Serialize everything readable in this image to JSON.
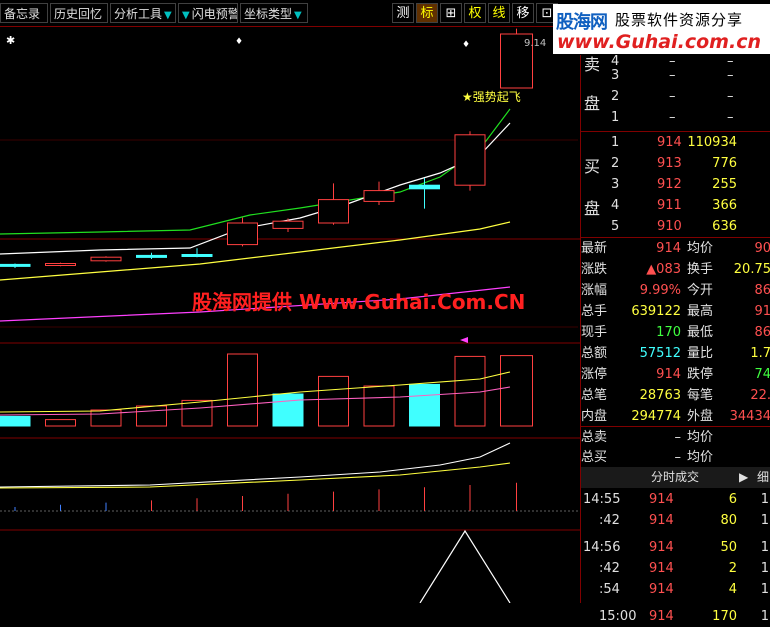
{
  "toolbar": {
    "memo": "备忘录",
    "history": "历史回忆",
    "analysis": "分析工具",
    "flash": "闪电预警",
    "coord": "坐标类型",
    "sq_measure": "测",
    "sq_mark": "标",
    "sq_plus": "⊞",
    "sq_right": "权",
    "sq_line": "线",
    "sq_move": "移",
    "sq_more": "⊡"
  },
  "logo": {
    "brand": "股海网",
    "slogan": "股票软件资源分享",
    "url": "www.Guhai.com.cn"
  },
  "chart": {
    "annotation": "★强势起飞",
    "price_label": "9.14",
    "watermark": "股海网提供 Www.Guhai.Com.CN"
  },
  "orderbook": {
    "sell_label_1": "卖",
    "sell_label_2": "盘",
    "buy_label_1": "买",
    "buy_label_2": "盘",
    "sell": [
      {
        "level": "4",
        "price": "–",
        "vol": "–"
      },
      {
        "level": "3",
        "price": "–",
        "vol": "–"
      },
      {
        "level": "2",
        "price": "–",
        "vol": "–"
      },
      {
        "level": "1",
        "price": "–",
        "vol": "–"
      }
    ],
    "buy": [
      {
        "level": "1",
        "price": "914",
        "vol": "110934"
      },
      {
        "level": "2",
        "price": "913",
        "vol": "776"
      },
      {
        "level": "3",
        "price": "912",
        "vol": "255"
      },
      {
        "level": "4",
        "price": "911",
        "vol": "366"
      },
      {
        "level": "5",
        "price": "910",
        "vol": "636"
      }
    ]
  },
  "quote": [
    {
      "l1": "最新",
      "v1": "914",
      "l2": "均价",
      "v2": "90"
    },
    {
      "l1": "涨跌",
      "v1": "▲083",
      "l2": "换手",
      "v2": "20.75"
    },
    {
      "l1": "涨幅",
      "v1": "9.99%",
      "l2": "今开",
      "v2": "86"
    },
    {
      "l1": "总手",
      "v1": "639122",
      "l2": "最高",
      "v2": "91"
    },
    {
      "l1": "现手",
      "v1": "170",
      "l2": "最低",
      "v2": "86"
    },
    {
      "l1": "总额",
      "v1": "57512",
      "l2": "量比",
      "v2": "1.7"
    },
    {
      "l1": "涨停",
      "v1": "914",
      "l2": "跌停",
      "v2": "74"
    },
    {
      "l1": "总笔",
      "v1": "28763",
      "l2": "每笔",
      "v2": "22."
    },
    {
      "l1": "内盘",
      "v1": "294774",
      "l2": "外盘",
      "v2": "34434"
    }
  ],
  "totals": [
    {
      "l1": "总卖",
      "v1": "–",
      "l2": "均价",
      "v2": ""
    },
    {
      "l1": "总买",
      "v1": "–",
      "l2": "均价",
      "v2": ""
    }
  ],
  "ticks": {
    "title": "分时成交",
    "tab2": "细",
    "rows": [
      {
        "time": "14:55",
        "price": "914",
        "vol": "6",
        "dir": "1"
      },
      {
        "time": ":42",
        "price": "914",
        "vol": "80",
        "dir": "1"
      },
      {
        "time": "14:56",
        "price": "914",
        "vol": "50",
        "dir": "1"
      },
      {
        "time": ":42",
        "price": "914",
        "vol": "2",
        "dir": "1"
      },
      {
        "time": ":54",
        "price": "914",
        "vol": "4",
        "dir": "1"
      },
      {
        "time": "15:00",
        "price": "914",
        "vol": "170",
        "dir": "1"
      }
    ]
  },
  "chart_data": {
    "type": "candlestick",
    "candles": [
      {
        "o": 0.06,
        "c": 0.07,
        "h": 0.075,
        "l": 0.05,
        "color": "cyan"
      },
      {
        "o": 0.065,
        "c": 0.075,
        "h": 0.08,
        "l": 0.06,
        "color": "red"
      },
      {
        "o": 0.09,
        "c": 0.11,
        "h": 0.115,
        "l": 0.085,
        "color": "red"
      },
      {
        "o": 0.12,
        "c": 0.12,
        "h": 0.135,
        "l": 0.1,
        "color": "cyan"
      },
      {
        "o": 0.125,
        "c": 0.125,
        "h": 0.16,
        "l": 0.11,
        "color": "cyan"
      },
      {
        "o": 0.18,
        "c": 0.3,
        "h": 0.33,
        "l": 0.17,
        "color": "red"
      },
      {
        "o": 0.27,
        "c": 0.31,
        "h": 0.325,
        "l": 0.25,
        "color": "red"
      },
      {
        "o": 0.3,
        "c": 0.43,
        "h": 0.52,
        "l": 0.29,
        "color": "red"
      },
      {
        "o": 0.42,
        "c": 0.48,
        "h": 0.53,
        "l": 0.4,
        "color": "red"
      },
      {
        "o": 0.49,
        "c": 0.51,
        "h": 0.55,
        "l": 0.38,
        "color": "cyan"
      },
      {
        "o": 0.51,
        "c": 0.79,
        "h": 0.81,
        "l": 0.48,
        "color": "red"
      },
      {
        "o": 1.05,
        "c": 1.35,
        "h": 1.38,
        "l": 1.05,
        "color": "red"
      }
    ],
    "volume": [
      0.12,
      0.08,
      0.2,
      0.25,
      0.32,
      0.9,
      0.4,
      0.62,
      0.5,
      0.52,
      0.87,
      0.88
    ],
    "volume_color": [
      "cyan",
      "red",
      "red",
      "red",
      "red",
      "red",
      "cyan",
      "red",
      "red",
      "cyan",
      "red",
      "red"
    ]
  }
}
